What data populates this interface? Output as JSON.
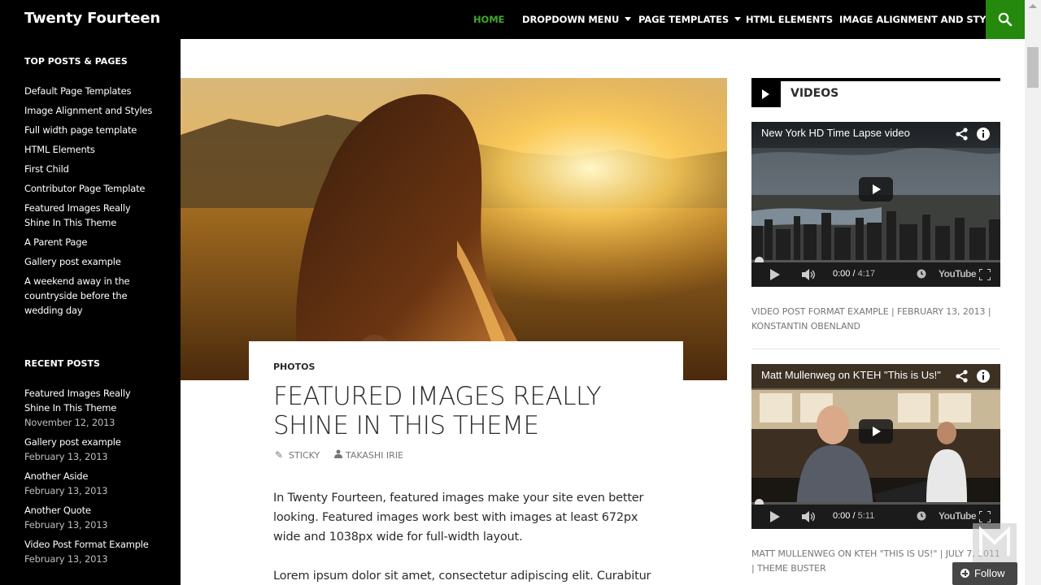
{
  "header": {
    "site_title": "Twenty Fourteen",
    "nav": [
      {
        "label": "HOME",
        "active": true
      },
      {
        "label": "DROPDOWN MENU",
        "has_caret": true
      },
      {
        "label": "PAGE TEMPLATES",
        "has_caret": true
      },
      {
        "label": "HTML ELEMENTS"
      },
      {
        "label": "IMAGE ALIGNMENT AND STYLES"
      }
    ],
    "search_icon": "search-icon",
    "accent_color": "#24890d",
    "active_color": "#41a62a"
  },
  "sidebar": {
    "top_posts_title": "TOP POSTS & PAGES",
    "top_posts": [
      "Default Page Templates",
      "Image Alignment and Styles",
      "Full width page template",
      "HTML Elements",
      "First Child",
      "Contributor Page Template",
      "Featured Images Really Shine In This Theme",
      "A Parent Page",
      "Gallery post example",
      "A weekend away in the countryside before the wedding day"
    ],
    "recent_posts_title": "RECENT POSTS",
    "recent_posts": [
      {
        "title": "Featured Images Really Shine In This Theme",
        "date": "November 12, 2013"
      },
      {
        "title": "Gallery post example",
        "date": "February 13, 2013"
      },
      {
        "title": "Another Aside",
        "date": "February 13, 2013"
      },
      {
        "title": "Another Quote",
        "date": "February 13, 2013"
      },
      {
        "title": "Video Post Format Example",
        "date": "February 13, 2013"
      }
    ]
  },
  "post": {
    "category": "PHOTOS",
    "title": "FEATURED IMAGES REALLY SHINE IN THIS THEME",
    "sticky_label": "STICKY",
    "author": "TAKASHI IRIE",
    "paragraphs": [
      "In Twenty Fourteen, featured images make your site even better looking. Featured images work best with images at least 672px wide and 1038px wide for full-width layout.",
      "Lorem ipsum dolor sit amet, consectetur adipiscing elit. Curabitur"
    ]
  },
  "videos_widget": {
    "title": "VIDEOS",
    "videos": [
      {
        "title": "New York HD Time Lapse video",
        "current_time": "0:00",
        "duration": "4:17",
        "meta": "VIDEO POST FORMAT EXAMPLE | FEBRUARY 13, 2013 | KONSTANTIN OBENLAND"
      },
      {
        "title": "Matt Mullenweg on KTEH \"This is Us!\"",
        "current_time": "0:00",
        "duration": "5:11",
        "meta": "MATT MULLENWEG ON KTEH \"THIS IS US!\" | JULY 7, 2011 | THEME BUSTER"
      }
    ],
    "youtube_label": "YouTube"
  },
  "follow_button": {
    "label": "Follow"
  }
}
